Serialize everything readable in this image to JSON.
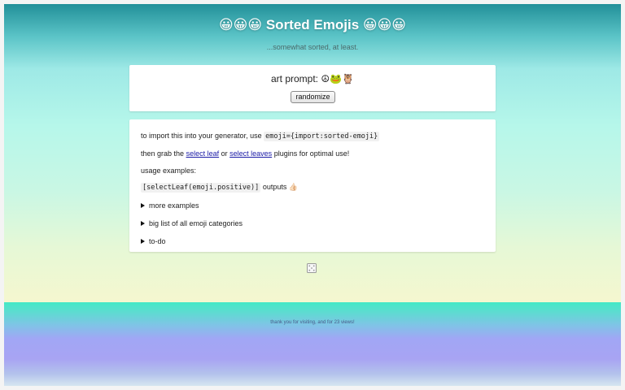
{
  "header": {
    "title": "😀😀😀 Sorted Emojis 😀😀😀",
    "subtitle": "...somewhat sorted, at least."
  },
  "prompt_card": {
    "prompt_label": "art prompt:",
    "prompt_value": "☮🐸🦉",
    "randomize_label": "randomize"
  },
  "info_card": {
    "import_text_before": "to import this into your generator, use",
    "import_code": "emoji={import:sorted-emoji}",
    "grab_text_before": "then grab the",
    "select_leaf_link": "select leaf",
    "or_text": "or",
    "select_leaves_link": "select leaves",
    "grab_text_after": "plugins for optimal use!",
    "usage_label": "usage examples:",
    "example_code": "[selectLeaf(emoji.positive)]",
    "example_outputs_label": "outputs",
    "example_output_value": "👍🏻",
    "details": [
      {
        "label": "more examples"
      },
      {
        "label": "big list of all emoji categories"
      },
      {
        "label": "to-do"
      }
    ]
  },
  "dice_icon": "dice-icon",
  "footer": {
    "text": "thank you for visiting, and for 23 views!"
  },
  "colors": {
    "header_teal": "#229099",
    "mint": "#b6f7ea",
    "cream": "#f5f7cf",
    "footer_aqua": "#44e9c6",
    "footer_lavender": "#a1a6f5",
    "link": "#1a1aa6"
  }
}
